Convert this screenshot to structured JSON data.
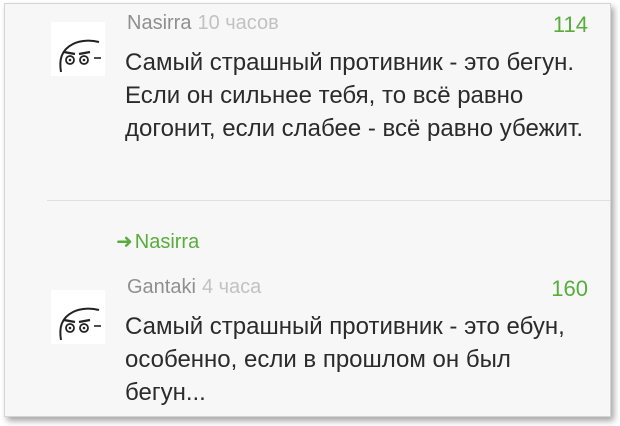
{
  "comments": [
    {
      "author": "Nasirra",
      "time": "10 часов",
      "score": "114",
      "text": "Самый страшный противник - это бегун. Если он сильнее тебя, то всё равно догонит, если слабее - всё равно убежит."
    },
    {
      "author": "Gantaki",
      "time": "4 часа",
      "score": "160",
      "text": "Самый страшный противник - это ебун, особенно, если в прошлом он был бегун..."
    }
  ],
  "reply": {
    "icon": "reply-arrow-icon",
    "target": "Nasirra"
  },
  "colors": {
    "accent": "#58ad3c",
    "author": "#8f8f8f",
    "time": "#c2c2c2",
    "text": "#2b2b2b",
    "background": "#f7f7f7"
  }
}
